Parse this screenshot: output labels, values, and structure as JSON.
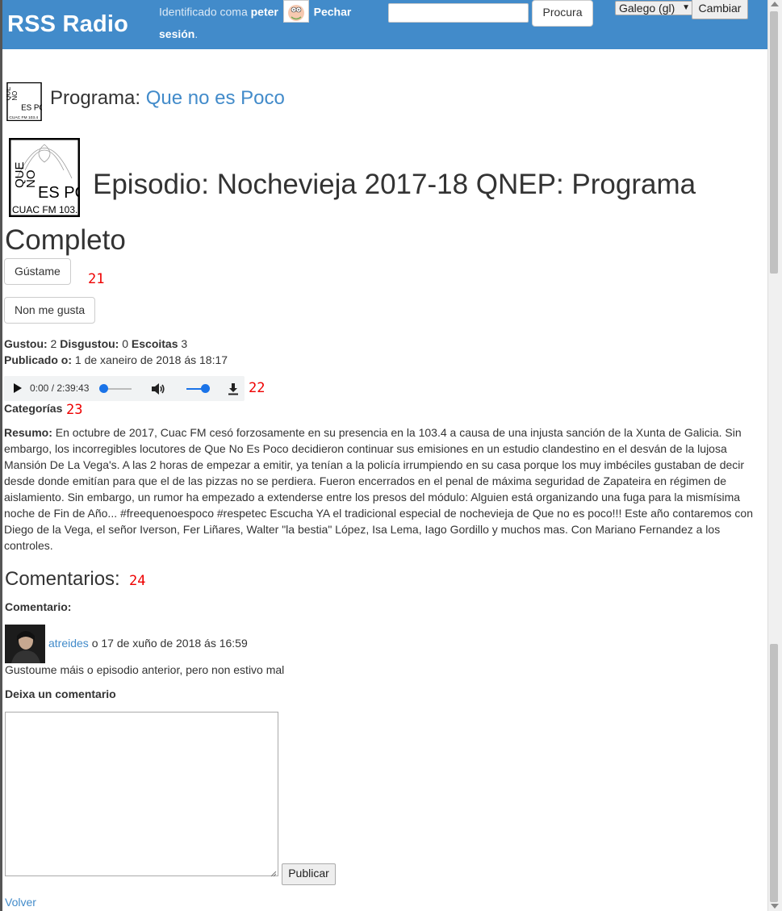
{
  "header": {
    "brand": "RSS Radio",
    "logged_prefix": "Identificado coma",
    "username": "peter",
    "logout": "Pechar sesión",
    "search_button": "Procura",
    "language": "Galego (gl)",
    "change_button": "Cambiar"
  },
  "program": {
    "label": "Programa:",
    "name": "Que no es Poco"
  },
  "episode": {
    "label": "Episodio:",
    "title": "Nochevieja 2017-18 QNEP: Programa Completo",
    "like_button": "Gústame",
    "dislike_button": "Non me gusta",
    "badge_likes": "21",
    "badge_audio": "22",
    "badge_categories": "23",
    "badge_comments": "24",
    "liked_label": "Gustou:",
    "liked_value": "2",
    "disliked_label": "Disgustou:",
    "disliked_value": "0",
    "listens_label": "Escoitas",
    "listens_value": "3",
    "published_label": "Publicado o:",
    "published_value": "1 de xaneiro de 2018 ás 18:17",
    "audio_time": "0:00 / 2:39:43",
    "categories_label": "Categorías",
    "summary_label": "Resumo:",
    "summary": "En octubre de 2017, Cuac FM cesó forzosamente en su presencia en la 103.4 a causa de una injusta sanción de la Xunta de Galicia. Sin embargo, los incorregibles locutores de Que No Es Poco decidieron continuar sus emisiones en un estudio clandestino en el desván de la lujosa Mansión De La Vega's. A las 2 horas de empezar a emitir, ya tenían a la policía irrumpiendo en su casa porque los muy imbéciles gustaban de decir desde donde emitían para que el de las pizzas no se perdiera. Fueron encerrados en el penal de máxima seguridad de Zapateira en régimen de aislamiento. Sin embargo, un rumor ha empezado a extenderse entre los presos del módulo: Alguien está organizando una fuga para la mismísima noche de Fin de Año... #freequenoespoco #respetec Escucha YA el tradicional especial de nochevieja de Que no es poco!!! Este año contaremos con Diego de la Vega, el señor Iverson, Fer Liñares, Walter \"la bestia\" López, Isa Lema, Iago Gordillo y muchos mas. Con Mariano Fernandez a los controles."
  },
  "comments": {
    "heading": "Comentarios:",
    "comment_label": "Comentario:",
    "items": [
      {
        "author": "atreides",
        "date": "o 17 de xuño de 2018 ás 16:59",
        "text": "Gustoume máis o episodio anterior, pero non estivo mal"
      }
    ],
    "leave_label": "Deixa un comentario",
    "publish_button": "Publicar",
    "back_link": "Volver"
  },
  "logo_text": {
    "line1": "QUE",
    "line2": "NO",
    "line3": "ES POCO",
    "line4": "CUAC FM 103.4"
  },
  "colors": {
    "header_bg": "#428bca",
    "link": "#428bca",
    "badge": "#e00000"
  }
}
